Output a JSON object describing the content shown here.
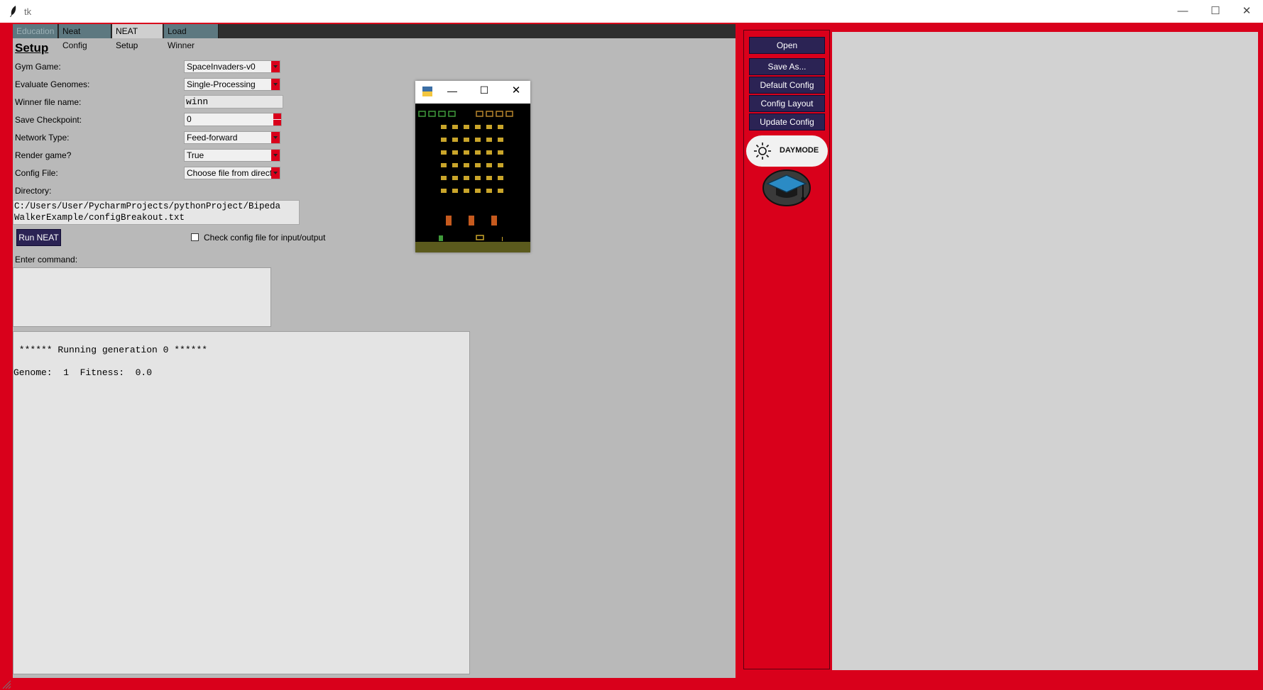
{
  "window": {
    "title": "tk"
  },
  "tabs": [
    {
      "label": "Education",
      "state": "disabled"
    },
    {
      "label": "Neat Config",
      "state": "inactive"
    },
    {
      "label": "NEAT Setup",
      "state": "active"
    },
    {
      "label": "Load Winner",
      "state": "inactive"
    }
  ],
  "setup": {
    "heading": "Setup",
    "fields": {
      "gym_game": {
        "label": "Gym Game:",
        "value": "SpaceInvaders-v0"
      },
      "evaluate_genomes": {
        "label": "Evaluate Genomes:",
        "value": "Single-Processing"
      },
      "winner_file": {
        "label": "Winner file name:",
        "value": "winn"
      },
      "save_checkpoint": {
        "label": "Save Checkpoint:",
        "value": "0"
      },
      "network_type": {
        "label": "Network Type:",
        "value": "Feed-forward"
      },
      "render_game": {
        "label": "Render game?",
        "value": "True"
      },
      "config_file": {
        "label": "Config File:",
        "value": "Choose file from direct"
      }
    },
    "directory_label": "Directory:",
    "directory_line1": "C:/Users/User/PycharmProjects/pythonProject/Bipeda",
    "directory_line2": "WalkerExample/configBreakout.txt",
    "run_button": "Run NEAT",
    "check_label": "Check config file for input/output",
    "command_label": "Enter command:"
  },
  "output": {
    "line1": " ****** Running generation 0 ******",
    "line2": "Genome:  1  Fitness:  0.0"
  },
  "sidebar": {
    "buttons": [
      "Open",
      "Save As...",
      "Default Config",
      "Config Layout",
      "Update Config"
    ],
    "daymode_label": "DAYMODE"
  },
  "colors": {
    "frame_red": "#d9001b",
    "button_navy": "#2b2354",
    "pane_gray": "#b9b9b9",
    "tab_teal": "#5d7880"
  },
  "icons": [
    "feather-icon",
    "sun-icon",
    "graduation-cap-icon",
    "python-icon",
    "minimize-icon",
    "maximize-icon",
    "close-icon"
  ]
}
